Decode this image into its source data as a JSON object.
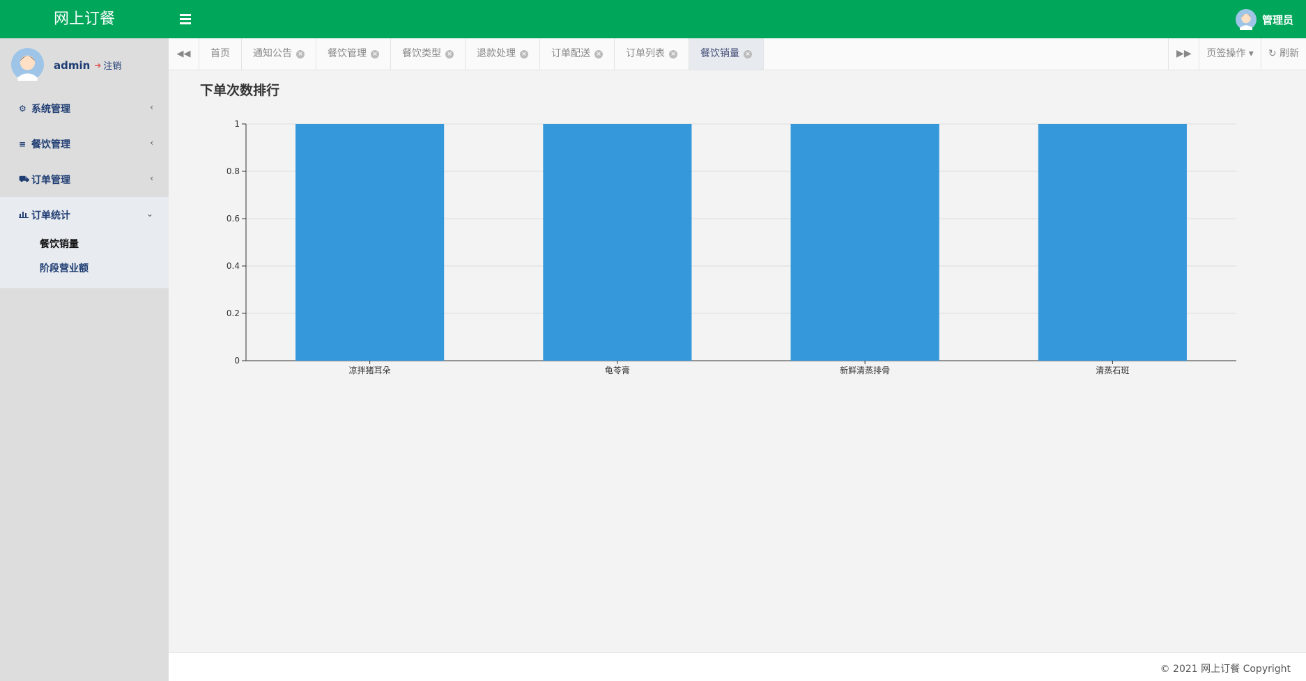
{
  "header": {
    "brand": "网上订餐",
    "role": "管理员"
  },
  "user": {
    "name": "admin",
    "logout": "注销"
  },
  "sidebar": {
    "items": [
      {
        "label": "系统管理",
        "icon": "gear-icon"
      },
      {
        "label": "餐饮管理",
        "icon": "list-icon"
      },
      {
        "label": "订单管理",
        "icon": "cart-icon"
      },
      {
        "label": "订单统计",
        "icon": "bar-chart-icon"
      }
    ],
    "subitems": [
      {
        "label": "餐饮销量"
      },
      {
        "label": "阶段营业额"
      }
    ]
  },
  "tabs": [
    {
      "label": "首页"
    },
    {
      "label": "通知公告"
    },
    {
      "label": "餐饮管理"
    },
    {
      "label": "餐饮类型"
    },
    {
      "label": "退款处理"
    },
    {
      "label": "订单配送"
    },
    {
      "label": "订单列表"
    },
    {
      "label": "餐饮销量"
    }
  ],
  "tab_actions": {
    "page_ops": "页签操作",
    "refresh": "刷新"
  },
  "chart_data": {
    "type": "bar",
    "title": "下单次数排行",
    "categories": [
      "凉拌猪耳朵",
      "龟苓膏",
      "新鲜清蒸排骨",
      "清蒸石斑"
    ],
    "values": [
      1,
      1,
      1,
      1
    ],
    "ylim": [
      0,
      1
    ],
    "yticks": [
      "0",
      "0.2",
      "0.4",
      "0.6",
      "0.8",
      "1"
    ],
    "grid": true,
    "bar_color": "#3498db"
  },
  "footer": {
    "copyright": "© 2021 网上订餐 Copyright"
  },
  "colors": {
    "topbar": "#00a65a",
    "sidebar": "#dddddd",
    "accent": "#1f3d73"
  }
}
